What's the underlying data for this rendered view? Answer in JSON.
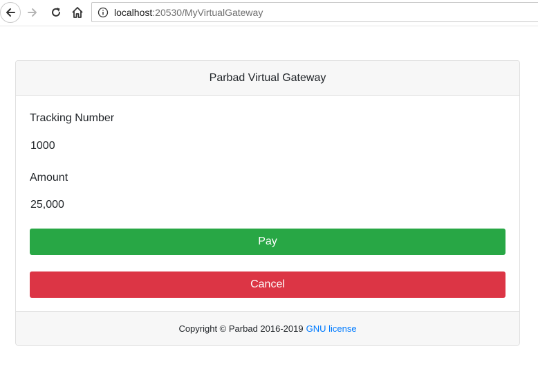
{
  "browser": {
    "back_icon": "arrow-left-icon",
    "forward_icon": "arrow-right-icon",
    "reload_icon": "reload-icon",
    "home_icon": "home-icon",
    "info_icon": "info-icon",
    "url_host": "localhost",
    "url_rest": ":20530/MyVirtualGateway"
  },
  "card": {
    "title": "Parbad Virtual Gateway",
    "tracking_label": "Tracking Number",
    "tracking_value": "1000",
    "amount_label": "Amount",
    "amount_value": "25,000",
    "pay_label": "Pay",
    "cancel_label": "Cancel"
  },
  "footer": {
    "copyright": "Copyright © Parbad 2016-2019",
    "license_link": "GNU license"
  },
  "colors": {
    "pay": "#28a745",
    "cancel": "#dc3545",
    "link": "#007bff"
  }
}
